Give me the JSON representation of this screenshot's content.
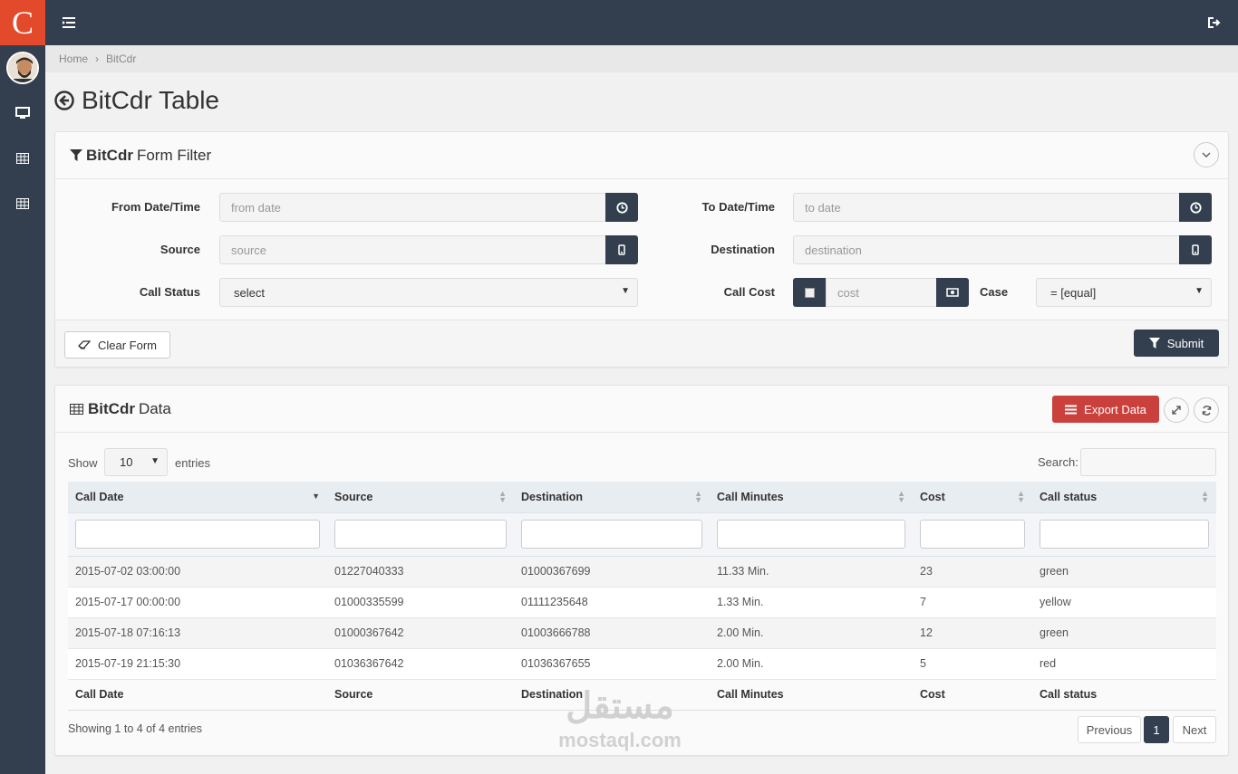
{
  "brand": {
    "letter": "C",
    "color": "#e34a2b"
  },
  "sidebar": {
    "items": [
      {
        "icon": "desktop-icon"
      },
      {
        "icon": "table-icon"
      },
      {
        "icon": "table-icon"
      }
    ]
  },
  "topbar": {
    "menu_icon": "menu-toggle-icon",
    "logout_icon": "logout-icon"
  },
  "breadcrumb": {
    "home": "Home",
    "sep": "›",
    "current": "BitCdr"
  },
  "page": {
    "title": "BitCdr Table"
  },
  "filter": {
    "title_bold": "BitCdr",
    "title_rest": "Form Filter",
    "from_label": "From Date/Time",
    "from_placeholder": "from date",
    "to_label": "To Date/Time",
    "to_placeholder": "to date",
    "source_label": "Source",
    "source_placeholder": "source",
    "destination_label": "Destination",
    "destination_placeholder": "destination",
    "status_label": "Call Status",
    "status_value": "select",
    "cost_label": "Call Cost",
    "cost_placeholder": "cost",
    "case_label": "Case",
    "case_value": "= [equal]",
    "clear_label": "Clear Form",
    "submit_label": "Submit"
  },
  "data_panel": {
    "title_bold": "BitCdr",
    "title_rest": "Data",
    "export_label": "Export Data",
    "show_label": "Show",
    "entries_value": "10",
    "entries_label": "entries",
    "search_label": "Search:",
    "columns": [
      "Call Date",
      "Source",
      "Destination",
      "Call Minutes",
      "Cost",
      "Call status"
    ],
    "rows": [
      [
        "2015-07-02 03:00:00",
        "01227040333",
        "01000367699",
        "11.33 Min.",
        "23",
        "green"
      ],
      [
        "2015-07-17 00:00:00",
        "01000335599",
        "01111235648",
        "1.33 Min.",
        "7",
        "yellow"
      ],
      [
        "2015-07-18 07:16:13",
        "01000367642",
        "01003666788",
        "2.00 Min.",
        "12",
        "green"
      ],
      [
        "2015-07-19 21:15:30",
        "01036367642",
        "01036367655",
        "2.00 Min.",
        "5",
        "red"
      ]
    ],
    "info": "Showing 1 to 4 of 4 entries",
    "pagination": {
      "previous": "Previous",
      "page": "1",
      "next": "Next"
    }
  },
  "watermark": {
    "arabic": "مستقل",
    "latin": "mostaql.com"
  }
}
